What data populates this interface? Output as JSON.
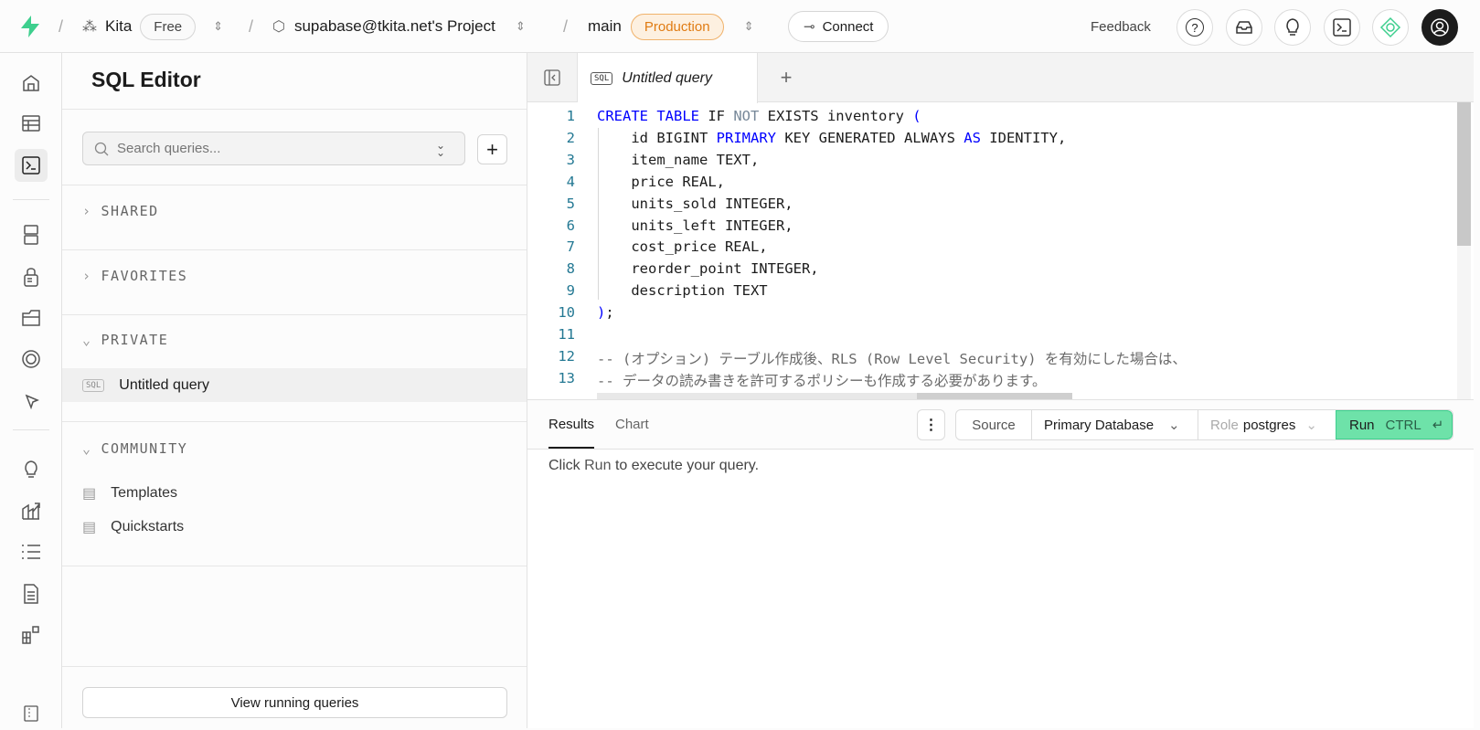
{
  "topbar": {
    "org": "Kita",
    "plan": "Free",
    "project": "supabase@tkita.net's Project",
    "branch": "main",
    "env": "Production",
    "connect": "Connect",
    "feedback": "Feedback",
    "icons": [
      "help-icon",
      "inbox-icon",
      "lightbulb-icon",
      "terminal-icon",
      "assistant-icon",
      "avatar"
    ]
  },
  "rail": {
    "items": [
      "home",
      "table-editor",
      "sql-editor",
      "database",
      "auth",
      "storage",
      "realtime",
      "edge-functions",
      "advisors",
      "reports",
      "logs",
      "api-docs",
      "integrations",
      "settings"
    ],
    "active": "sql-editor"
  },
  "sidebar": {
    "title": "SQL Editor",
    "search_placeholder": "Search queries...",
    "sections": {
      "shared": "SHARED",
      "favorites": "FAVORITES",
      "private": "PRIVATE",
      "community": "COMMUNITY"
    },
    "private_items": [
      {
        "badge": "SQL",
        "label": "Untitled query"
      }
    ],
    "community_items": [
      {
        "label": "Templates"
      },
      {
        "label": "Quickstarts"
      }
    ],
    "view_running": "View running queries"
  },
  "editor": {
    "tab_badge": "SQL",
    "tab_label": "Untitled query",
    "lines": [
      [
        {
          "t": "CREATE TABLE",
          "k": "kw"
        },
        {
          "t": " IF ",
          "k": ""
        },
        {
          "t": "NOT",
          "k": "kw2"
        },
        {
          "t": " EXISTS inventory ",
          "k": ""
        },
        {
          "t": "(",
          "k": "kw"
        }
      ],
      [
        {
          "t": "    id BIGINT ",
          "k": ""
        },
        {
          "t": "PRIMARY",
          "k": "kw"
        },
        {
          "t": " KEY GENERATED ALWAYS ",
          "k": ""
        },
        {
          "t": "AS",
          "k": "kw"
        },
        {
          "t": " IDENTITY,",
          "k": ""
        }
      ],
      [
        {
          "t": "    item_name TEXT,",
          "k": ""
        }
      ],
      [
        {
          "t": "    price REAL,",
          "k": ""
        }
      ],
      [
        {
          "t": "    units_sold INTEGER,",
          "k": ""
        }
      ],
      [
        {
          "t": "    units_left INTEGER,",
          "k": ""
        }
      ],
      [
        {
          "t": "    cost_price REAL,",
          "k": ""
        }
      ],
      [
        {
          "t": "    reorder_point INTEGER,",
          "k": ""
        }
      ],
      [
        {
          "t": "    description TEXT",
          "k": ""
        }
      ],
      [
        {
          "t": ")",
          "k": "kw"
        },
        {
          "t": ";",
          "k": ""
        }
      ],
      [],
      [
        {
          "t": "-- (オプション) テーブル作成後、RLS (Row Level Security) を有効にした場合は、",
          "k": "cm"
        }
      ],
      [
        {
          "t": "-- データの読み書きを許可するポリシーも作成する必要があります。",
          "k": "cm"
        }
      ]
    ]
  },
  "results": {
    "tabs": [
      "Results",
      "Chart"
    ],
    "source_label": "Source",
    "database": "Primary Database",
    "role_label": "Role",
    "role": "postgres",
    "run": "Run",
    "shortcut": "CTRL",
    "message_pre": "Click",
    "message_run": "Run",
    "message_post": "to execute your query."
  },
  "colors": {
    "brand": "#3ecf8e",
    "run_bg": "#6ee2a9",
    "production": "#e07b12"
  }
}
